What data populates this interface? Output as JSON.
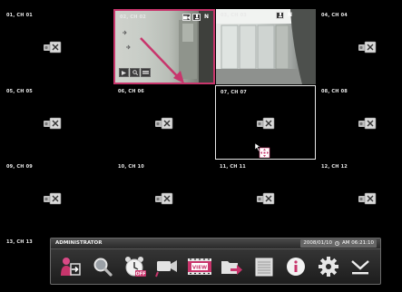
{
  "channels": [
    {
      "id": "ch01",
      "label": "01, CH 01"
    },
    {
      "id": "ch02",
      "label": "02, CH 02"
    },
    {
      "id": "ch03",
      "label": "03, CH 03"
    },
    {
      "id": "ch04",
      "label": "04, CH 04"
    },
    {
      "id": "ch05",
      "label": "05, CH 05"
    },
    {
      "id": "ch06",
      "label": "06, CH 06"
    },
    {
      "id": "ch07",
      "label": "07, CH 07"
    },
    {
      "id": "ch08",
      "label": "08, CH 08"
    },
    {
      "id": "ch09",
      "label": "09, CH 09"
    },
    {
      "id": "ch10",
      "label": "10, CH 10"
    },
    {
      "id": "ch11",
      "label": "11, CH 11"
    },
    {
      "id": "ch12",
      "label": "12, CH 12"
    },
    {
      "id": "ch13",
      "label": "13, CH 13"
    }
  ],
  "tile_overlay": {
    "n_badge": "N"
  },
  "menu": {
    "user": "ADMINISTRATOR",
    "date": "2008/01/10",
    "time": "AM 06:21:10",
    "buttons": [
      {
        "name": "logout-icon"
      },
      {
        "name": "search-icon"
      },
      {
        "name": "schedule-clock-icon",
        "badge": "OFF"
      },
      {
        "name": "camera-record-icon"
      },
      {
        "name": "view-icon",
        "badge": "VIEW"
      },
      {
        "name": "export-icon"
      },
      {
        "name": "settings-panel-icon"
      },
      {
        "name": "info-icon"
      },
      {
        "name": "gear-icon"
      },
      {
        "name": "hide-menu-icon"
      }
    ]
  },
  "colors": {
    "selection_red": "#c8356c",
    "selection_white": "#e8e8e8",
    "background": "#000000"
  }
}
